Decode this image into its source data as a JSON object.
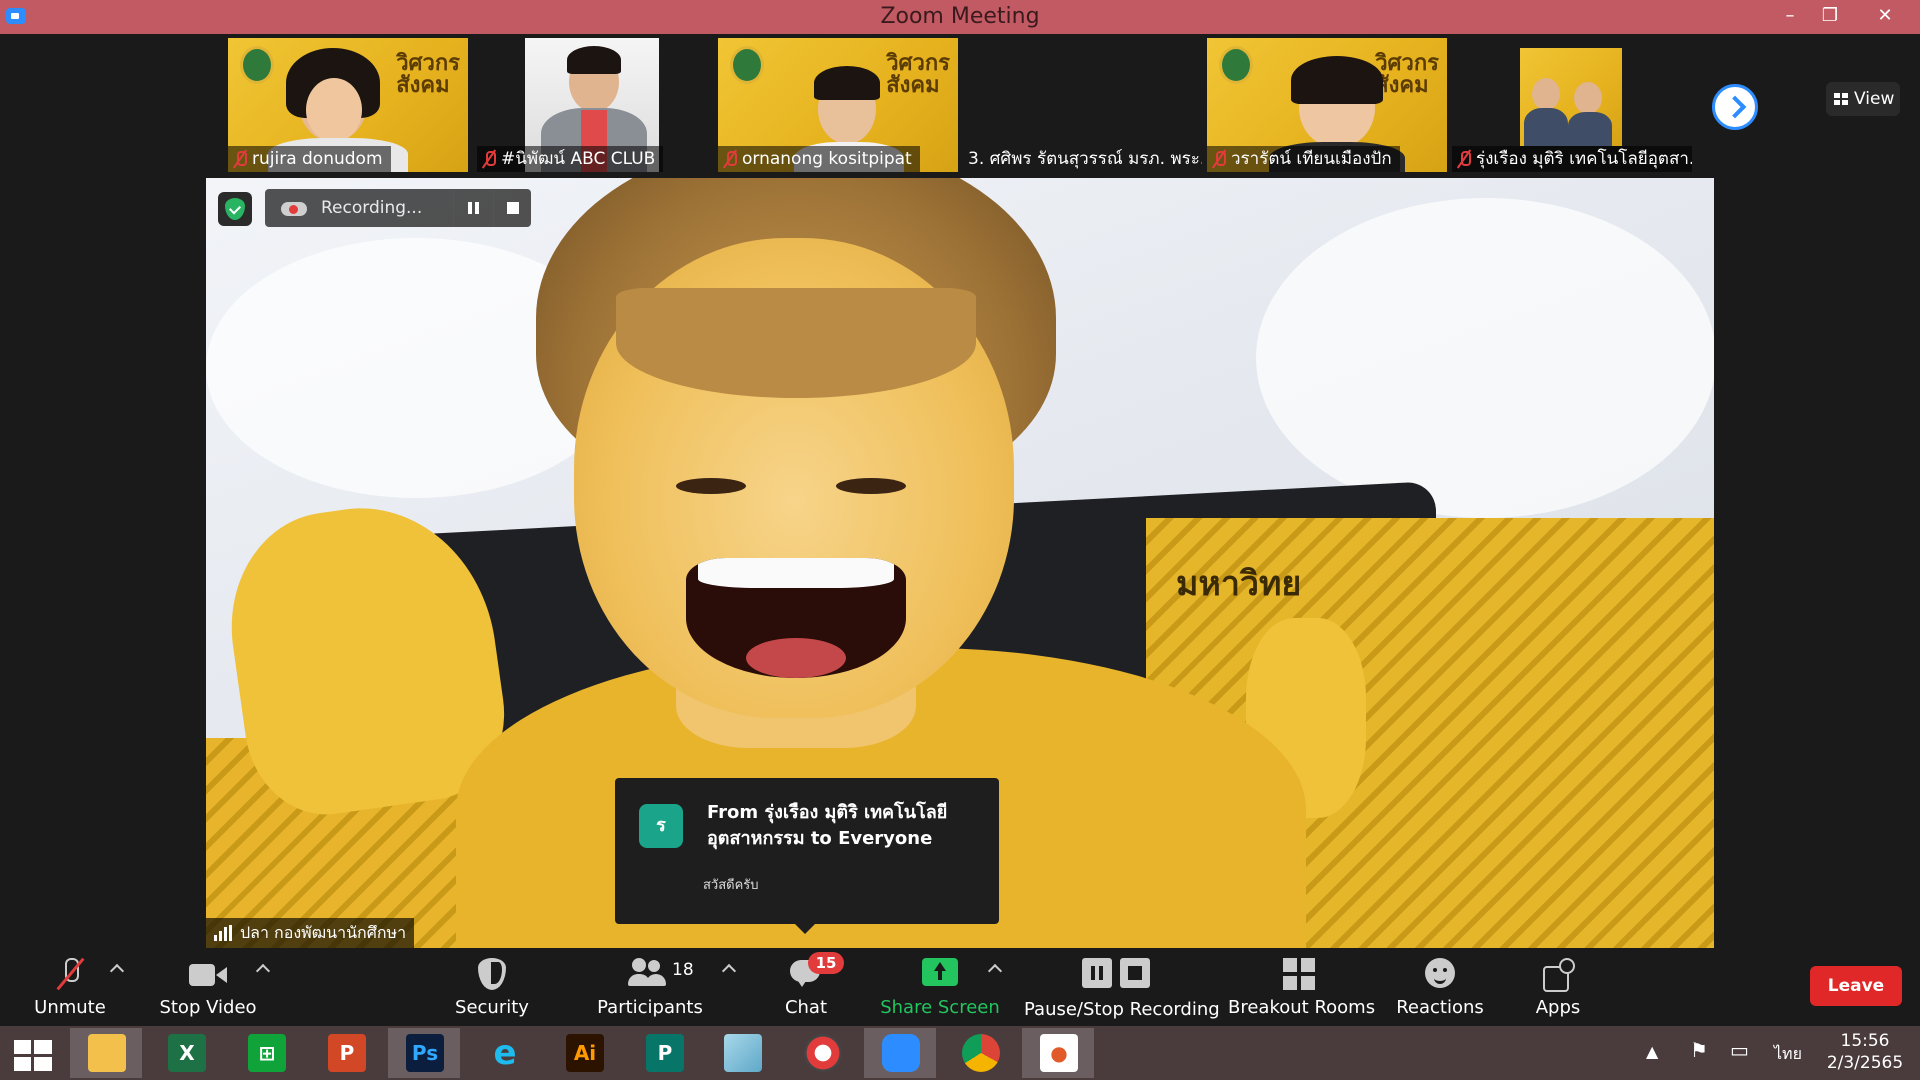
{
  "window": {
    "title": "Zoom Meeting",
    "minimize": "–",
    "restore": "❐",
    "close": "✕"
  },
  "thumbnails": [
    {
      "name": "rujira donudom",
      "muted": true
    },
    {
      "name": "#นิพัฒน์ ABC CLUB",
      "muted": true
    },
    {
      "name": "ornanong kositpipat",
      "muted": true
    },
    {
      "name": "3. ศศิพร รัตนสุวรรณ์ มรภ. พระ...",
      "muted": false
    },
    {
      "name": "วรารัตน์ เทียนเมืองปัก",
      "muted": true
    },
    {
      "name": "รุ่งเรือง มุติริ เทคโนโลยีอุตสา...",
      "muted": true
    }
  ],
  "poster_text": "วิศวกร\nสังคม",
  "view_label": "View",
  "recording": {
    "label": "Recording..."
  },
  "main_video": {
    "speaker_name": "ปลา กองพัฒนานักศึกษา",
    "backdrop_text": "มหาวิทย"
  },
  "chat_popup": {
    "avatar_letter": "ร",
    "from": "From รุ่งเรือง มุติริ เทคโนโลยีอุตสาหกรรม to Everyone",
    "message": "สวัสดีครับ"
  },
  "toolbar": {
    "unmute": "Unmute",
    "stop_video": "Stop Video",
    "security": "Security",
    "participants": "Participants",
    "participants_count": "18",
    "chat": "Chat",
    "chat_badge": "15",
    "share_screen": "Share Screen",
    "pause_stop_recording": "Pause/Stop Recording",
    "breakout_rooms": "Breakout Rooms",
    "reactions": "Reactions",
    "apps": "Apps",
    "leave": "Leave"
  },
  "taskbar": {
    "apps": [
      "file-explorer",
      "excel",
      "store",
      "powerpoint",
      "photoshop",
      "internet-explorer",
      "illustrator",
      "publisher",
      "notepad",
      "photoscape",
      "zoom",
      "chrome",
      "presentation"
    ],
    "language": "ไทย",
    "time": "15:56",
    "date": "2/3/2565"
  },
  "colors": {
    "titlebar": "#c25a63",
    "accent_blue": "#2d8cff",
    "share_green": "#23c55e",
    "leave_red": "#e02828",
    "poster_yellow": "#e6b21e"
  }
}
